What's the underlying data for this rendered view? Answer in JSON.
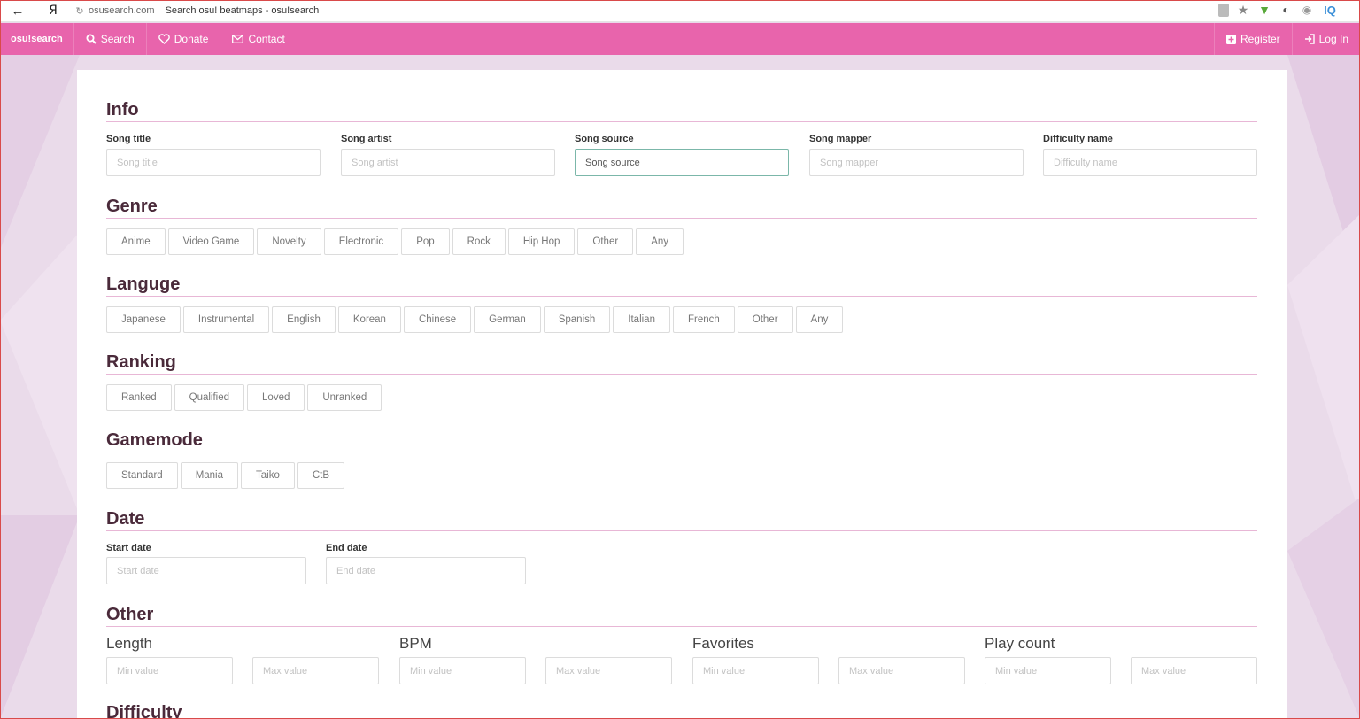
{
  "browser": {
    "url": "osusearch.com",
    "page_title": "Search osu! beatmaps - osu!search",
    "ya": "Я",
    "iq": "IQ"
  },
  "navbar": {
    "brand": "osu!search",
    "search": "Search",
    "donate": "Donate",
    "contact": "Contact",
    "register": "Register",
    "login": "Log In"
  },
  "info": {
    "heading": "Info",
    "fields": [
      {
        "label": "Song title",
        "placeholder": "Song title"
      },
      {
        "label": "Song artist",
        "placeholder": "Song artist"
      },
      {
        "label": "Song source",
        "placeholder": "Song source"
      },
      {
        "label": "Song mapper",
        "placeholder": "Song mapper"
      },
      {
        "label": "Difficulty name",
        "placeholder": "Difficulty name"
      }
    ]
  },
  "genre": {
    "heading": "Genre",
    "options": [
      "Anime",
      "Video Game",
      "Novelty",
      "Electronic",
      "Pop",
      "Rock",
      "Hip Hop",
      "Other",
      "Any"
    ]
  },
  "language": {
    "heading": "Languge",
    "options": [
      "Japanese",
      "Instrumental",
      "English",
      "Korean",
      "Chinese",
      "German",
      "Spanish",
      "Italian",
      "French",
      "Other",
      "Any"
    ]
  },
  "ranking": {
    "heading": "Ranking",
    "options": [
      "Ranked",
      "Qualified",
      "Loved",
      "Unranked"
    ]
  },
  "gamemode": {
    "heading": "Gamemode",
    "options": [
      "Standard",
      "Mania",
      "Taiko",
      "CtB"
    ]
  },
  "date": {
    "heading": "Date",
    "start_label": "Start date",
    "start_placeholder": "Start date",
    "end_label": "End date",
    "end_placeholder": "End date"
  },
  "other": {
    "heading": "Other",
    "groups": [
      {
        "label": "Length",
        "min_placeholder": "Min value",
        "max_placeholder": "Max value"
      },
      {
        "label": "BPM",
        "min_placeholder": "Min value",
        "max_placeholder": "Max value"
      },
      {
        "label": "Favorites",
        "min_placeholder": "Min value",
        "max_placeholder": "Max value"
      },
      {
        "label": "Play count",
        "min_placeholder": "Min value",
        "max_placeholder": "Max value"
      }
    ]
  },
  "difficulty": {
    "heading": "Difficulty"
  }
}
